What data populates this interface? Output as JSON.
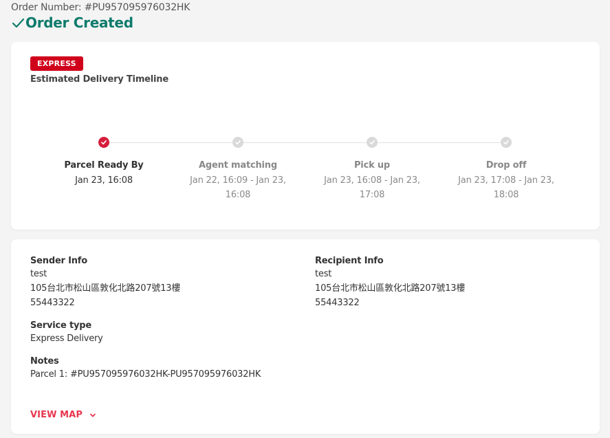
{
  "order": {
    "number_label": "Order Number: #PU957095976032HK",
    "status": "Order Created"
  },
  "timeline": {
    "badge": "EXPRESS",
    "title": "Estimated Delivery Timeline",
    "steps": [
      {
        "label": "Parcel Ready By",
        "time": "Jan 23, 16:08",
        "state": "done"
      },
      {
        "label": "Agent matching",
        "time": "Jan 22, 16:09 - Jan 23, 16:08",
        "state": "pending"
      },
      {
        "label": "Pick up",
        "time": "Jan 23, 16:08 - Jan 23, 17:08",
        "state": "pending"
      },
      {
        "label": "Drop off",
        "time": "Jan 23, 17:08 - Jan 23, 18:08",
        "state": "pending"
      }
    ]
  },
  "sender": {
    "title": "Sender Info",
    "name": "test",
    "address": "105台北市松山區敦化北路207號13樓",
    "phone": "55443322"
  },
  "recipient": {
    "title": "Recipient Info",
    "name": "test",
    "address": "105台北市松山區敦化北路207號13樓",
    "phone": "55443322"
  },
  "service": {
    "title": "Service type",
    "value": "Express Delivery"
  },
  "notes": {
    "title": "Notes",
    "value": "Parcel 1: #PU957095976032HK-PU957095976032HK"
  },
  "map_toggle": {
    "label": "VIEW MAP"
  },
  "colors": {
    "status_green": "#0f7b6c",
    "express_red": "#d0021b",
    "step_active": "#d61f3c",
    "step_inactive": "#d9d9d9",
    "link_red": "#e8364f"
  },
  "icons": {
    "status": "check-icon",
    "step": "check-circle-icon",
    "map_toggle": "chevron-down-icon"
  }
}
